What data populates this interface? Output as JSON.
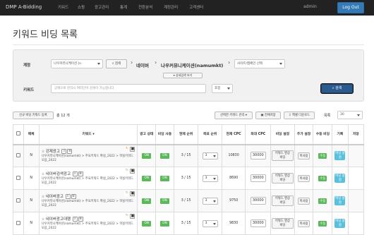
{
  "nav": {
    "brand": "DMP A-Bidding",
    "items": [
      "키워드",
      "쇼핑",
      "광고관리",
      "통계",
      "전환분석",
      "계정관리",
      "고객센터"
    ],
    "user": "admin",
    "logout": "Log Out"
  },
  "page_title": "키워드 비딩 목록",
  "filter": {
    "account_label": "계정",
    "account_value": "나우커뮤니케이션 (n",
    "account_search_btn": "검색",
    "crumb_network": "네이버",
    "crumb_account": "나우커뮤니케이션(namumkt)",
    "campaign_placeholder": "사이트/캠페인 선택",
    "detail_toggle": "상세검색 보기",
    "keyword_label": "키워드",
    "keyword_placeholder": "공백으로 분리시 여러단어 검색이 가능합니다.",
    "match_value": "포함",
    "search_btn": "검색"
  },
  "toolbar": {
    "register_btn": "신규 비딩 키워드 등록",
    "total_prefix": "총",
    "total_count": "12",
    "total_suffix": "개",
    "manage_btn": "선택한 키워드 관리",
    "save_all_btn": "전체저장",
    "excel_btn": "엑셀 다운로드",
    "page_size_label": "목록",
    "page_size_value": "30"
  },
  "table": {
    "headers": {
      "check": "",
      "sel": "매체",
      "keyword": "키워드",
      "adstate": "광고 상태",
      "bidstate": "비딩 사용",
      "curpos": "현재 순위",
      "target": "목표 순위",
      "curcpc": "현재 CPC",
      "maxcpc": "최대 CPC",
      "bidset": "비딩 설정",
      "extra": "추가 설정",
      "manual": "수동 비딩",
      "history": "기록",
      "save": "저장"
    },
    "rows": [
      {
        "media": "N",
        "name": "강제광고",
        "path": "나우커뮤니케이션(namumkt) > 주요키워드 확실_2022 > 학실키워드 모음_2022",
        "adstate": "ON",
        "bidstate": "ON",
        "curpos": "3 / 15",
        "target": "3",
        "curcpc": "10830",
        "maxcpc": "30000",
        "bidset": "키워드 영상비딩",
        "extra": "미사용",
        "manual": "수동",
        "history": "비딩 설정"
      },
      {
        "media": "N",
        "name": "네이버검색광고",
        "path": "나우커뮤니케이션(namumkt) > 주요키워드 확실_2022 > 학실키워드 모음_2022",
        "adstate": "ON",
        "bidstate": "ON",
        "curpos": "3 / 15",
        "target": "3",
        "curcpc": "8690",
        "maxcpc": "30000",
        "bidset": "키워드 영상비딩",
        "extra": "미사용",
        "manual": "수동",
        "history": "비딩 설정"
      },
      {
        "media": "N",
        "name": "네이버광고",
        "path": "나우커뮤니케이션(namumkt) > 주요키워드 확실_2022 > 학실키워드 모음_2022",
        "adstate": "ON",
        "bidstate": "ON",
        "curpos": "3 / 15",
        "target": "3",
        "curcpc": "9750",
        "maxcpc": "30000",
        "bidset": "키워드 영상비딩",
        "extra": "미사용",
        "manual": "수동",
        "history": "비딩 설정"
      },
      {
        "media": "N",
        "name": "네이버광고대행",
        "path": "나우커뮤니케이션(namumkt) > 주요키워드 확실_2022 > 학실키워드 모음_2022",
        "adstate": "ON",
        "bidstate": "ON",
        "curpos": "3 / 15",
        "target": "3",
        "curcpc": "9830",
        "maxcpc": "30000",
        "bidset": "키워드 영상비딩",
        "extra": "미사용",
        "manual": "수동",
        "history": "비딩 설정"
      }
    ]
  }
}
